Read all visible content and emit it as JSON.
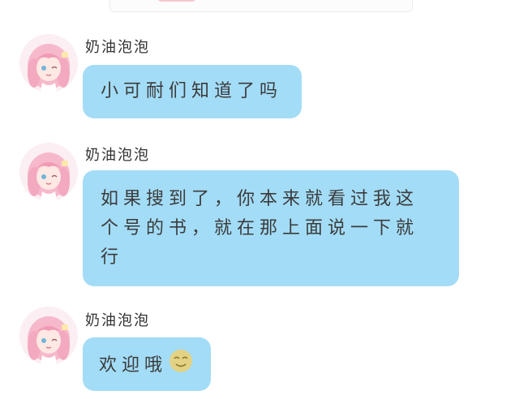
{
  "chat": {
    "messages": [
      {
        "sender": "奶油泡泡",
        "text": "小可耐们知道了吗"
      },
      {
        "sender": "奶油泡泡",
        "text": "如果搜到了，你本来就看过我这个号的书，就在那上面说一下就行"
      },
      {
        "sender": "奶油泡泡",
        "text": "欢迎哦",
        "emoji": "smiling-face-emoji"
      }
    ]
  },
  "colors": {
    "bubble": "#a3dcf6",
    "text": "#3b3b3b",
    "background": "#ffffff"
  }
}
